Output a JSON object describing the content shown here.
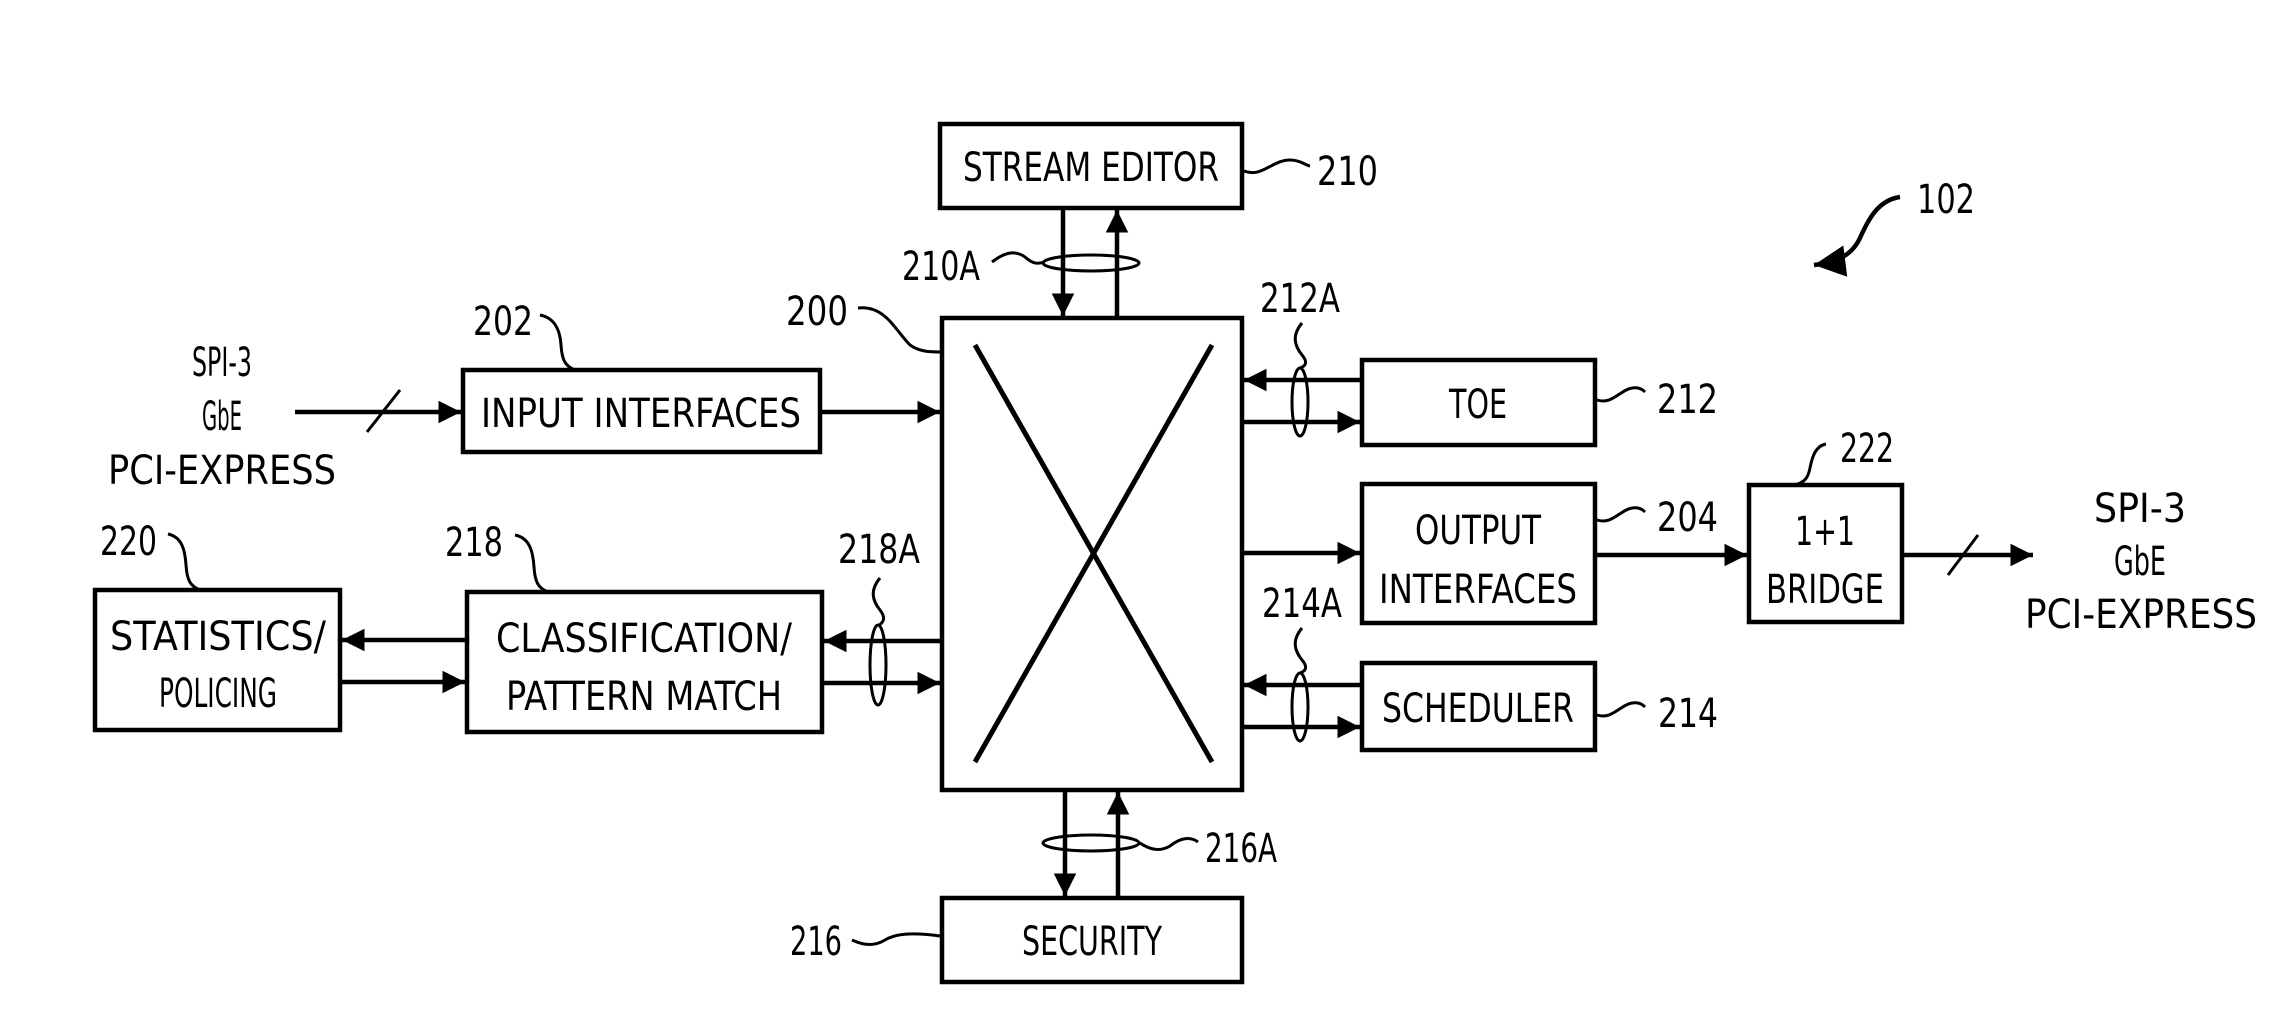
{
  "figure": {
    "reference": "102",
    "blocks": {
      "switch": {
        "ref": "200"
      },
      "input_interfaces": {
        "ref": "202",
        "lines": [
          "INPUT  INTERFACES"
        ]
      },
      "output_interfaces": {
        "ref": "204",
        "lines": [
          "OUTPUT",
          "INTERFACES"
        ]
      },
      "stream_editor": {
        "ref": "210",
        "lines": [
          "STREAM  EDITOR"
        ]
      },
      "toe": {
        "ref": "212",
        "lines": [
          "TOE"
        ]
      },
      "scheduler": {
        "ref": "214",
        "lines": [
          "SCHEDULER"
        ]
      },
      "security": {
        "ref": "216",
        "lines": [
          "SECURITY"
        ]
      },
      "classification": {
        "ref": "218",
        "lines": [
          "CLASSIFICATION/",
          "PATTERN  MATCH"
        ]
      },
      "statistics": {
        "ref": "220",
        "lines": [
          "STATISTICS/",
          "POLICING"
        ]
      },
      "bridge": {
        "ref": "222",
        "lines": [
          "1+1",
          "BRIDGE"
        ]
      }
    },
    "buses": {
      "stream_editor_bus": "210A",
      "toe_bus": "212A",
      "scheduler_bus": "214A",
      "security_bus": "216A",
      "classification_bus": "218A"
    },
    "input_protocols": [
      "SPI-3",
      "GbE",
      "PCI-EXPRESS"
    ],
    "output_protocols": [
      "SPI-3",
      "GbE",
      "PCI-EXPRESS"
    ]
  }
}
